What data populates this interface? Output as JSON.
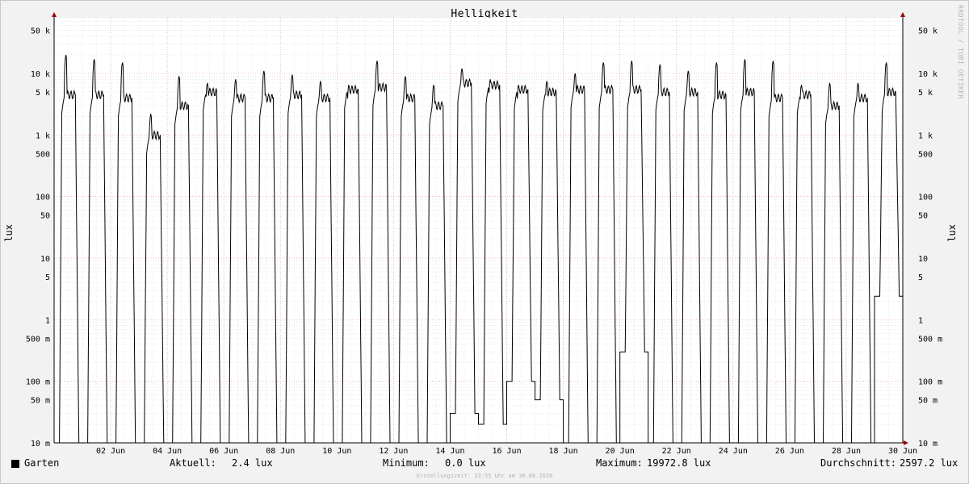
{
  "chart_data": {
    "type": "line",
    "title": "Helligkeit",
    "ylabel": "lux",
    "scale": "log",
    "ylim": [
      0.01,
      80000
    ],
    "y_ticks": [
      {
        "value": 50000,
        "label": "50 k"
      },
      {
        "value": 10000,
        "label": "10 k"
      },
      {
        "value": 5000,
        "label": "5 k"
      },
      {
        "value": 1000,
        "label": "1 k"
      },
      {
        "value": 500,
        "label": "500"
      },
      {
        "value": 100,
        "label": "100"
      },
      {
        "value": 50,
        "label": "50"
      },
      {
        "value": 10,
        "label": "10"
      },
      {
        "value": 5,
        "label": "5"
      },
      {
        "value": 1,
        "label": "1"
      },
      {
        "value": 0.5,
        "label": "500 m"
      },
      {
        "value": 0.1,
        "label": "100 m"
      },
      {
        "value": 0.05,
        "label": "50 m"
      },
      {
        "value": 0.01,
        "label": "10 m"
      }
    ],
    "x_range_days": [
      0,
      30
    ],
    "x_ticks": [
      {
        "day": 2,
        "label": "02 Jun"
      },
      {
        "day": 4,
        "label": "04 Jun"
      },
      {
        "day": 6,
        "label": "06 Jun"
      },
      {
        "day": 8,
        "label": "08 Jun"
      },
      {
        "day": 10,
        "label": "10 Jun"
      },
      {
        "day": 12,
        "label": "12 Jun"
      },
      {
        "day": 14,
        "label": "14 Jun"
      },
      {
        "day": 16,
        "label": "16 Jun"
      },
      {
        "day": 18,
        "label": "18 Jun"
      },
      {
        "day": 20,
        "label": "20 Jun"
      },
      {
        "day": 22,
        "label": "22 Jun"
      },
      {
        "day": 24,
        "label": "24 Jun"
      },
      {
        "day": 26,
        "label": "26 Jun"
      },
      {
        "day": 28,
        "label": "28 Jun"
      },
      {
        "day": 30,
        "label": "30 Jun"
      }
    ],
    "grid": true,
    "series": [
      {
        "name": "Garten",
        "color": "#000000",
        "daily_peak_lux": [
          20000,
          17000,
          15000,
          2200,
          9000,
          7000,
          8000,
          11000,
          9500,
          7500,
          6500,
          16000,
          9000,
          6500,
          12000,
          8000,
          6500,
          7500,
          10000,
          15000,
          16000,
          14000,
          11000,
          15000,
          17000,
          16000,
          6500,
          7000,
          7000,
          15000
        ],
        "daily_plateau_lux": [
          4500,
          4500,
          4000,
          1000,
          3000,
          5000,
          4000,
          4000,
          4500,
          4000,
          5500,
          6000,
          4000,
          3000,
          7000,
          6500,
          5500,
          5000,
          5500,
          5500,
          5500,
          5000,
          5000,
          4500,
          5000,
          4000,
          4500,
          3000,
          4000,
          5000
        ],
        "daily_night_min_lux": [
          0,
          0,
          0,
          0,
          0,
          0,
          0,
          0,
          0,
          0,
          0,
          0,
          0,
          0,
          0.03,
          0.02,
          0.1,
          0.05,
          0,
          0,
          0.3,
          0,
          0,
          0,
          0,
          0,
          0,
          0,
          0,
          2.4
        ]
      }
    ]
  },
  "legend": {
    "series_name": "Garten",
    "current_label": "Aktuell:",
    "current_value": "2.4 lux",
    "min_label": "Minimum:",
    "min_value": "0.0 lux",
    "max_label": "Maximum:",
    "max_value": "19972.8 lux",
    "avg_label": "Durchschnitt:",
    "avg_value": "2597.2 lux"
  },
  "watermark": "RRDTOOL / TOBI OETIKER",
  "footer": "Erstellungszeit: 23:55 Uhr am 30.06.2020"
}
